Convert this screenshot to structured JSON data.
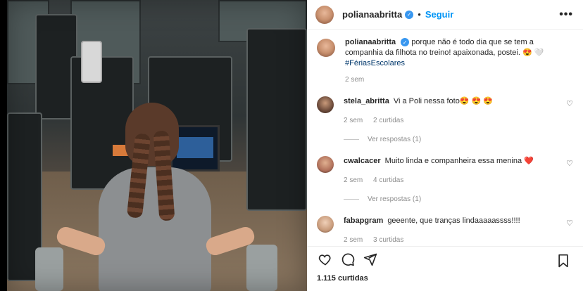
{
  "post": {
    "username": "polianaabritta",
    "follow_label": "Seguir",
    "more_label": "•••"
  },
  "caption": {
    "username": "polianaabritta",
    "text": "porque não é todo dia que se tem a companhia da filhota no treino! apaixonada, postei. 😍 🤍",
    "hashtag": "#FériasEscolares",
    "time": "2 sem"
  },
  "comments": [
    {
      "username": "stela_abritta",
      "text": "Vi a Poli nessa foto😍 😍 😍",
      "time": "2 sem",
      "likes": "2 curtidas",
      "replies": "Ver respostas (1)"
    },
    {
      "username": "cwalcacer",
      "text": "Muito linda e companheira essa menina ❤️",
      "time": "2 sem",
      "likes": "4 curtidas",
      "replies": "Ver respostas (1)"
    },
    {
      "username": "fabapgram",
      "text": "geeente, que tranças lindaaaaassss!!!!",
      "time": "2 sem",
      "likes": "3 curtidas",
      "replies": ""
    }
  ],
  "footer": {
    "likes_count": "1.115 curtidas"
  },
  "icons": {
    "like": "heart-icon",
    "comment": "comment-icon",
    "share": "share-icon",
    "save": "bookmark-icon"
  },
  "colors": {
    "accent": "#0095f6",
    "verified": "#3897f0",
    "heart": "#ed4956"
  }
}
